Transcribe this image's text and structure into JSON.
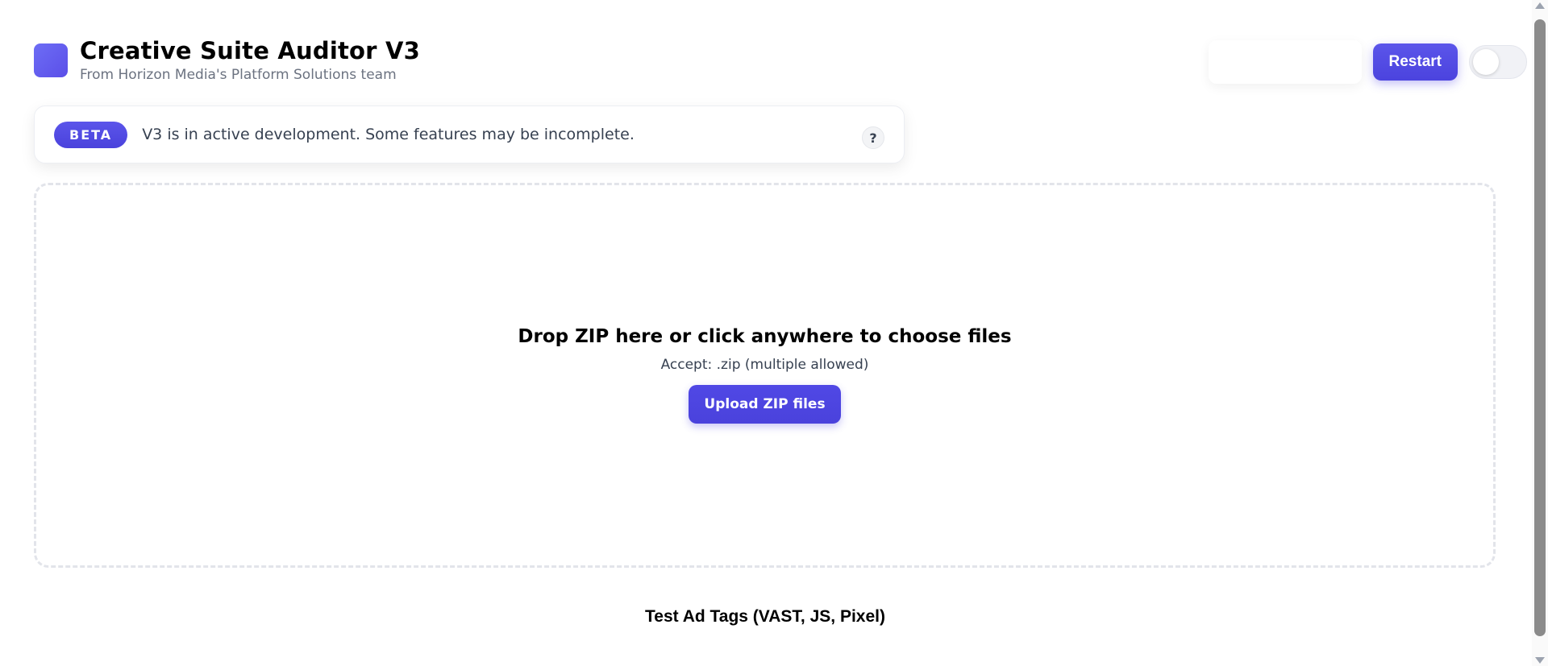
{
  "header": {
    "title": "Creative Suite Auditor V3",
    "subtitle": "From Horizon Media's Platform Solutions team",
    "logo_icon": "app-logo-square",
    "restart_label": "Restart",
    "theme_toggle": {
      "state": "off"
    }
  },
  "banner": {
    "badge": "BETA",
    "message": "V3 is in active development. Some features may be incomplete.",
    "help_label": "?"
  },
  "dropzone": {
    "title": "Drop ZIP here or click anywhere to choose files",
    "hint": "Accept: .zip (multiple allowed)",
    "upload_label": "Upload ZIP files"
  },
  "tags_section": {
    "heading": "Test Ad Tags (VAST, JS, Pixel)"
  },
  "colors": {
    "accent": "#4f46e5",
    "muted_text": "#6b7280",
    "border": "#e2e4ea"
  }
}
